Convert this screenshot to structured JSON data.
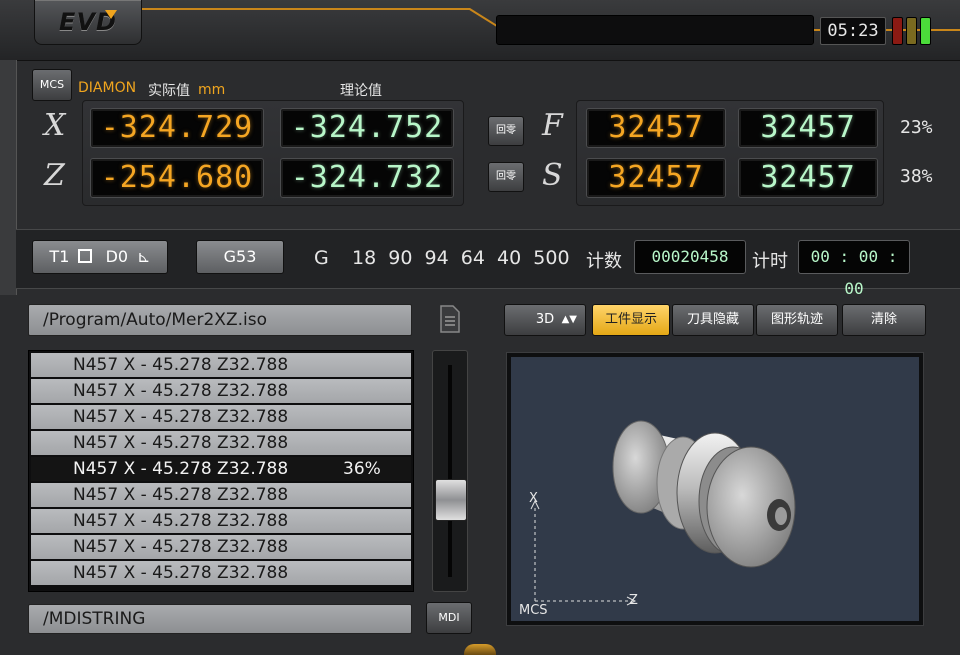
{
  "header": {
    "logo_text": "EVD",
    "time": "05:23",
    "leds": [
      "#8b1a13",
      "#7a6a20",
      "#4bdc3a"
    ]
  },
  "coords": {
    "mcs_label": "MCS",
    "diameter_label": "DIAMON",
    "actual_label": "实际值",
    "unit": "mm",
    "theory_label": "理论值",
    "axes": [
      {
        "letter": "X",
        "actual": "-324.729",
        "theory": "-324.752",
        "home_label": "回零"
      },
      {
        "letter": "Z",
        "actual": "-254.680",
        "theory": "-324.732",
        "home_label": "回零"
      }
    ],
    "feeds": [
      {
        "letter": "F",
        "actual": "32457",
        "set": "32457",
        "percent": "23%"
      },
      {
        "letter": "S",
        "actual": "32457",
        "set": "32457",
        "percent": "38%"
      }
    ]
  },
  "status_bar": {
    "tool": "T1",
    "offset": "D0",
    "coord_system": "G53",
    "g_label": "G",
    "g_codes": "18  90  94  64  40  500",
    "count_label": "计数",
    "count_value": "00020458",
    "timer_label": "计时",
    "timer_value": "00 : 00 : 00"
  },
  "program": {
    "path": "/Program/Auto/Mer2XZ.iso",
    "lines": [
      {
        "code": "N457  X - 45.278  Z32.788",
        "extra": ""
      },
      {
        "code": "N457  X - 45.278  Z32.788",
        "extra": ""
      },
      {
        "code": "N457  X - 45.278  Z32.788",
        "extra": ""
      },
      {
        "code": "N457  X - 45.278  Z32.788",
        "extra": ""
      },
      {
        "code": "N457  X - 45.278  Z32.788",
        "extra": "36%"
      },
      {
        "code": "N457  X - 45.278  Z32.788",
        "extra": ""
      },
      {
        "code": "N457  X - 45.278  Z32.788",
        "extra": ""
      },
      {
        "code": "N457  X - 45.278  Z32.788",
        "extra": ""
      },
      {
        "code": "N457  X - 45.278  Z32.788",
        "extra": ""
      }
    ],
    "active_index": 4,
    "mdi_string": "/MDISTRING",
    "mdi_button": "MDI"
  },
  "view": {
    "mode": "3D",
    "buttons": [
      "工件显示",
      "刀具隐藏",
      "图形轨迹",
      "清除"
    ],
    "active_button": 0,
    "axis_x": "X",
    "axis_z": "Z",
    "axis_origin": "MCS"
  }
}
